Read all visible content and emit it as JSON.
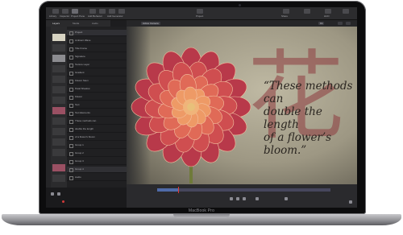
{
  "toolbar": {
    "left_items": [
      "Library",
      "Inspector",
      "Project Pane"
    ],
    "center_items": [
      "Add Behavior",
      "Add Filter",
      "Add Generator",
      "Add Animation"
    ],
    "right_items": [
      "Share",
      "Apply Transitions",
      "HUD",
      "Opacity"
    ],
    "center_label": "Project"
  },
  "panel_tabs": [
    "Layers",
    "Media",
    "Audio"
  ],
  "layers": [
    "Project",
    "Ambient Wave",
    "Title Frame",
    "Signature",
    "Texture Layer",
    "Gradient",
    "Flower Stem",
    "Petal Shadow",
    "Flower",
    "Text",
    "Text Elements",
    "These methods can",
    "double the length",
    "of a flower's bloom",
    "Group 1",
    "Group 2",
    "Group 3",
    "Group 4",
    "Audio"
  ],
  "canvas": {
    "view_label": "Active Camera",
    "zoom": "Fit",
    "quote_line1": "“These methods can",
    "quote_line2": "double the length",
    "quote_line3": "of a flower’s bloom.”",
    "kanji": "花"
  },
  "timeline": {
    "progress": 0.12
  },
  "device": {
    "brand_label": "MacBook Pro"
  },
  "colors": {
    "accent_red": "#e03a3a",
    "timeline_blue": "#4f6aa8",
    "petal": "#d9564f"
  }
}
